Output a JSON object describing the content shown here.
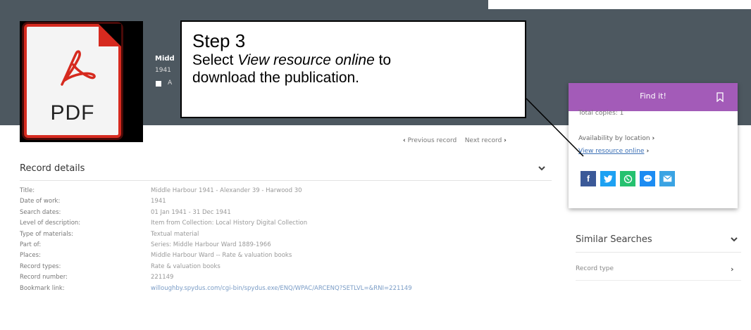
{
  "thumbnail": {
    "label": "PDF",
    "icon": "pdf-file-icon"
  },
  "record_header": {
    "title_short": "Midd",
    "year_short": "1941",
    "action_short": "A"
  },
  "callout": {
    "title": "Step 3",
    "line1_prefix": "Select ",
    "line1_emph": "View resource online",
    "line1_suffix": " to",
    "line2": "download the publication."
  },
  "find_it": {
    "title": "Find it!",
    "total_copies": "Total copies: 1",
    "availability": "Availability by location",
    "view_online": "View resource online",
    "accent": "#a35bb8",
    "share": [
      {
        "name": "facebook-icon",
        "glyph": "f",
        "color": "#3b5998"
      },
      {
        "name": "twitter-icon",
        "glyph": "t",
        "color": "#1da1f2"
      },
      {
        "name": "whatsapp-icon",
        "glyph": "w",
        "color": "#25c16f"
      },
      {
        "name": "messenger-icon",
        "glyph": "m",
        "color": "#1c8cf2"
      },
      {
        "name": "email-icon",
        "glyph": "e",
        "color": "#3aa3e3"
      }
    ]
  },
  "navigation": {
    "previous": "Previous record",
    "next": "Next record"
  },
  "record_details": {
    "heading": "Record details",
    "rows": [
      {
        "label": "Title:",
        "value": "Middle Harbour 1941 - Alexander 39 - Harwood 30"
      },
      {
        "label": "Date of work:",
        "value": "1941"
      },
      {
        "label": "Search dates:",
        "value": "01 Jan 1941 - 31 Dec 1941"
      },
      {
        "label": "Level of description:",
        "value": "Item from Collection: Local History Digital Collection"
      },
      {
        "label": "Type of materials:",
        "value": "Textual material"
      },
      {
        "label": "Part of:",
        "value": "Series: Middle Harbour Ward 1889-1966"
      },
      {
        "label": "Places:",
        "value": "Middle Harbour Ward -- Rate & valuation books"
      },
      {
        "label": "Record types:",
        "value": "Rate & valuation books"
      },
      {
        "label": "Record number:",
        "value": "221149"
      },
      {
        "label": "Bookmark link:",
        "value": "willoughby.spydus.com/cgi-bin/spydus.exe/ENQ/WPAC/ARCENQ?SETLVL=&RNI=221149"
      }
    ]
  },
  "similar_searches": {
    "heading": "Similar Searches",
    "item": "Record type"
  }
}
